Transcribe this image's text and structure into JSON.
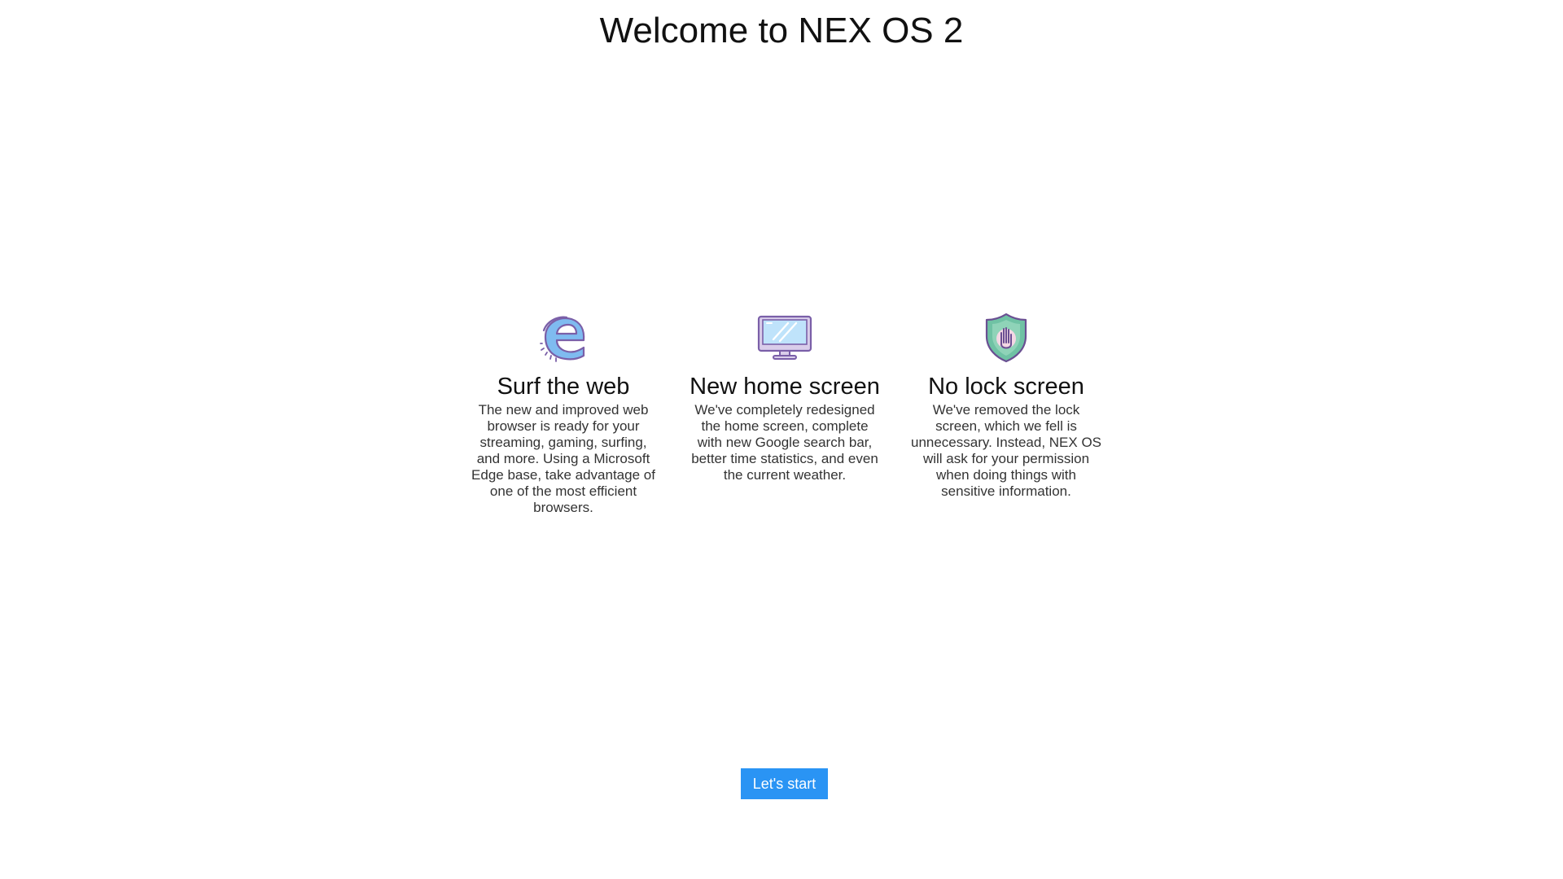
{
  "page": {
    "title": "Welcome to NEX OS 2"
  },
  "features": [
    {
      "icon": "edge-browser-icon",
      "heading": "Surf the web",
      "description": "The new and improved web browser is ready for your streaming, gaming, surfing, and more. Using a Microsoft Edge base, take advantage of one of the most efficient browsers."
    },
    {
      "icon": "monitor-icon",
      "heading": "New home screen",
      "description": "We've completely redesigned the home screen, complete with new Google search bar, better time statistics, and even the current weather."
    },
    {
      "icon": "shield-hand-icon",
      "heading": "No lock screen",
      "description": "We've removed the lock screen, which we fell is unnecessary. Instead, NEX OS will ask for your permission when doing things with sensitive information."
    }
  ],
  "actions": {
    "start_label": "Let's start"
  },
  "colors": {
    "accent": "#2a94f4",
    "icon_purple": "#8a6fb0",
    "icon_blue": "#5fa8e8",
    "icon_teal": "#5fb89a"
  }
}
